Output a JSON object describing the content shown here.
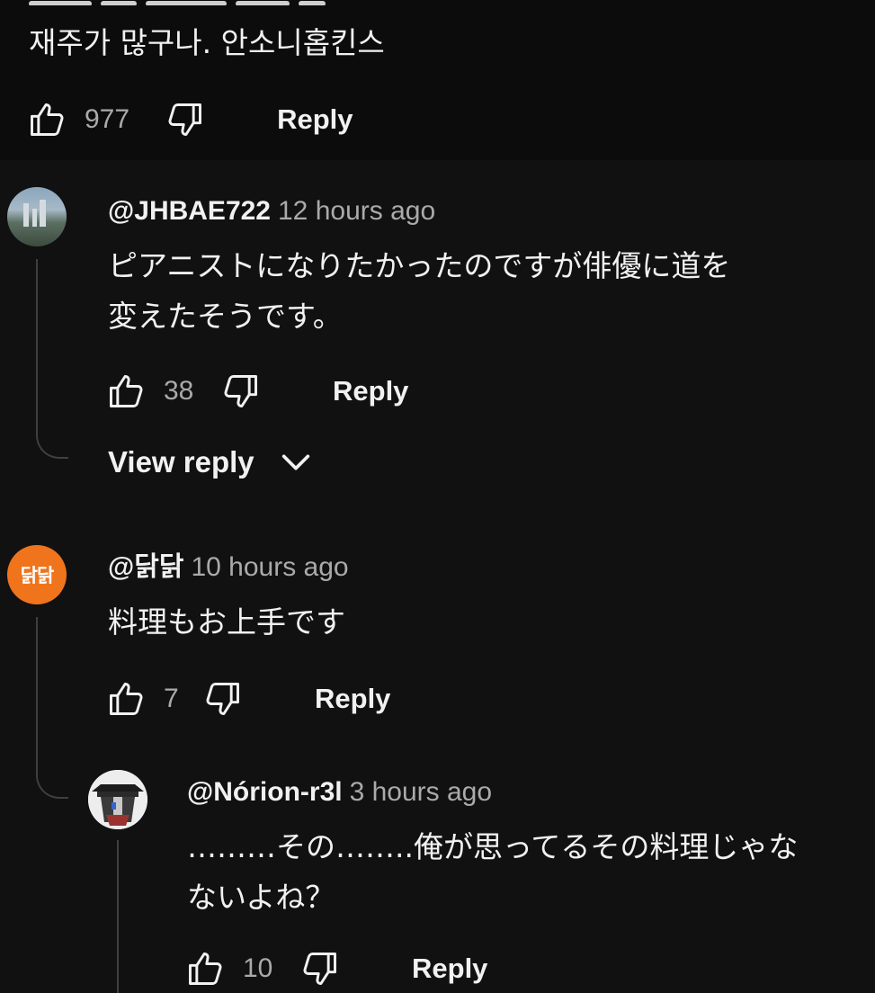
{
  "top_comment": {
    "text": "재주가 많구나. 안소니홉킨스",
    "likes": "977",
    "reply_label": "Reply"
  },
  "replies": [
    {
      "author": "@JHBAE722",
      "time": "12 hours ago",
      "text_lines": [
        "ピアニストになりたかったのですが俳優に道を",
        "変えたそうです。"
      ],
      "likes": "38",
      "reply_label": "Reply",
      "view_reply_label": "View reply"
    },
    {
      "author": "@닭닭",
      "avatar_text": "닭닭",
      "time": "10 hours ago",
      "text_lines": [
        "料理もお上手です"
      ],
      "likes": "7",
      "reply_label": "Reply"
    },
    {
      "author": "@Nórion-r3l",
      "time": "3 hours ago",
      "text_lines": [
        "………その……..俺が思ってるその料理じゃな",
        "ないよね？"
      ],
      "likes": "10",
      "reply_label": "Reply"
    }
  ],
  "icons": {
    "like": "thumbs-up-icon",
    "dislike": "thumbs-down-icon",
    "expand": "chevron-down-icon"
  },
  "colors": {
    "background": "#0f0f0f",
    "text": "#f1f1f1",
    "secondary_text": "#aaaaaa",
    "avatar_orange": "#f0741b"
  }
}
